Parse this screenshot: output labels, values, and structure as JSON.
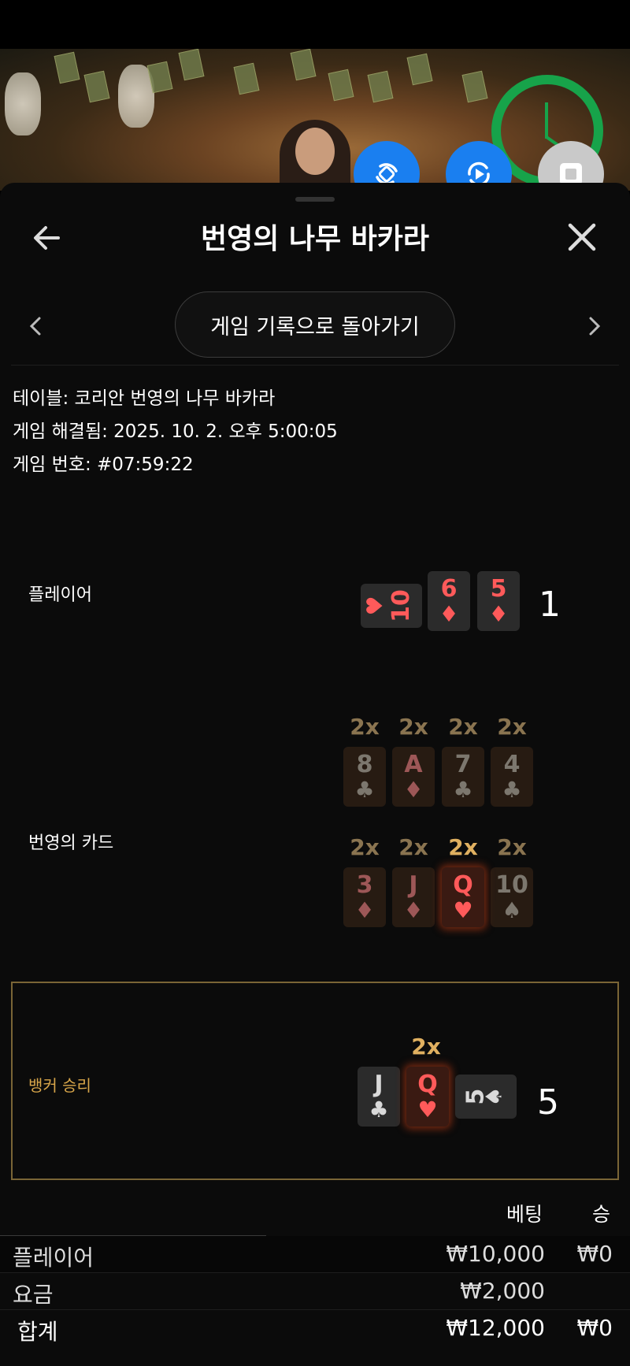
{
  "header": {
    "title": "번영의 나무 바카라"
  },
  "history_button": {
    "label": "게임 기록으로 돌아가기"
  },
  "info": {
    "table": "테이블: 코리안 번영의 나무 바카라",
    "resolved": "게임 해결됨: 2025. 10. 2. 오후 5:00:05",
    "game_no": "게임 번호: #07:59:22"
  },
  "player": {
    "label": "플레이어",
    "score": "1",
    "cards": [
      {
        "rank": "10",
        "suit": "♥",
        "color": "red",
        "orientation": "side"
      },
      {
        "rank": "6",
        "suit": "♦",
        "color": "red"
      },
      {
        "rank": "5",
        "suit": "♦",
        "color": "red"
      }
    ]
  },
  "prosperity": {
    "label": "번영의 카드",
    "row1": [
      {
        "mult": "2x",
        "rank": "8",
        "suit": "♣",
        "color": "black"
      },
      {
        "mult": "2x",
        "rank": "A",
        "suit": "♦",
        "color": "red"
      },
      {
        "mult": "2x",
        "rank": "7",
        "suit": "♣",
        "color": "black"
      },
      {
        "mult": "2x",
        "rank": "4",
        "suit": "♣",
        "color": "black"
      }
    ],
    "row2": [
      {
        "mult": "2x",
        "rank": "3",
        "suit": "♦",
        "color": "red"
      },
      {
        "mult": "2x",
        "rank": "J",
        "suit": "♦",
        "color": "red"
      },
      {
        "mult": "2x",
        "rank": "Q",
        "suit": "♥",
        "color": "red",
        "highlight": true
      },
      {
        "mult": "2x",
        "rank": "10",
        "suit": "♠",
        "color": "black"
      }
    ]
  },
  "banker": {
    "label": "뱅커 승리",
    "score": "5",
    "mult": "2x",
    "cards": [
      {
        "rank": "J",
        "suit": "♣",
        "color": "black"
      },
      {
        "rank": "Q",
        "suit": "♥",
        "color": "red",
        "highlight": true
      },
      {
        "rank": "5",
        "suit": "♠",
        "color": "black",
        "orientation": "side"
      }
    ]
  },
  "bets": {
    "col_bet": "베팅",
    "col_win": "승",
    "rows": [
      {
        "label": "플레이어",
        "bet": "₩10,000",
        "win": "₩0"
      },
      {
        "label": "요금",
        "bet": "₩2,000",
        "win": ""
      },
      {
        "label": "합계",
        "bet": "₩12,000",
        "win": "₩0"
      }
    ]
  },
  "icons": {
    "back": "arrow-left-icon",
    "close": "close-icon",
    "prev": "chevron-left-icon",
    "next": "chevron-right-icon",
    "rotate": "rotate-icon",
    "replay": "replay-icon",
    "stop": "stop-icon"
  },
  "colors": {
    "accent_blue": "#1a7ff0",
    "gold": "#d8a64a",
    "timer_green": "#17a34a",
    "card_red": "#ff5a5a"
  }
}
